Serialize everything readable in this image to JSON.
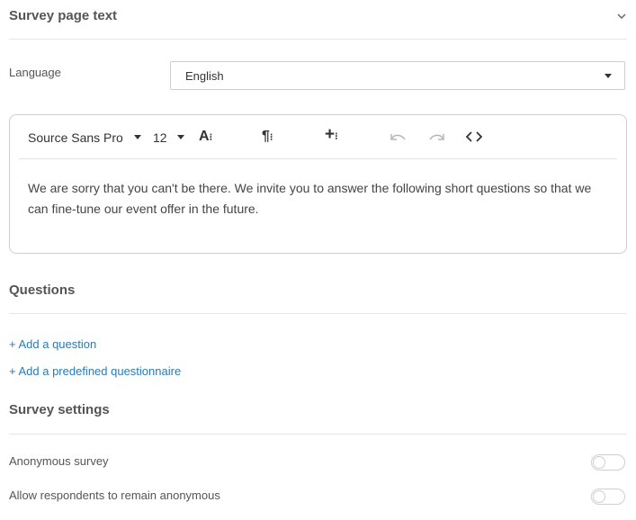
{
  "survey_page_text": {
    "title": "Survey page text",
    "toggle_icon": "chevron-down-icon"
  },
  "language": {
    "label": "Language",
    "selected": "English"
  },
  "editor": {
    "font_family": "Source Sans Pro",
    "font_size": "12",
    "icons": [
      "font-size-icon",
      "paragraph-icon",
      "insert-plus-icon",
      "undo-icon",
      "redo-icon",
      "code-view-icon"
    ],
    "content": "We are sorry that you can't be there. We invite you to answer the following short questions so that we can fine-tune our event offer in the future."
  },
  "questions": {
    "title": "Questions",
    "add_question": "+ Add a question",
    "add_predefined": "+ Add a predefined questionnaire"
  },
  "survey_settings": {
    "title": "Survey settings",
    "anonymous_label": "Anonymous survey",
    "allow_anonymous_label": "Allow respondents to remain anonymous",
    "anonymous_on": false,
    "allow_anonymous_on": false
  },
  "colors": {
    "link": "#2a7ab8",
    "text": "#555555",
    "border": "#cfcfcf"
  }
}
